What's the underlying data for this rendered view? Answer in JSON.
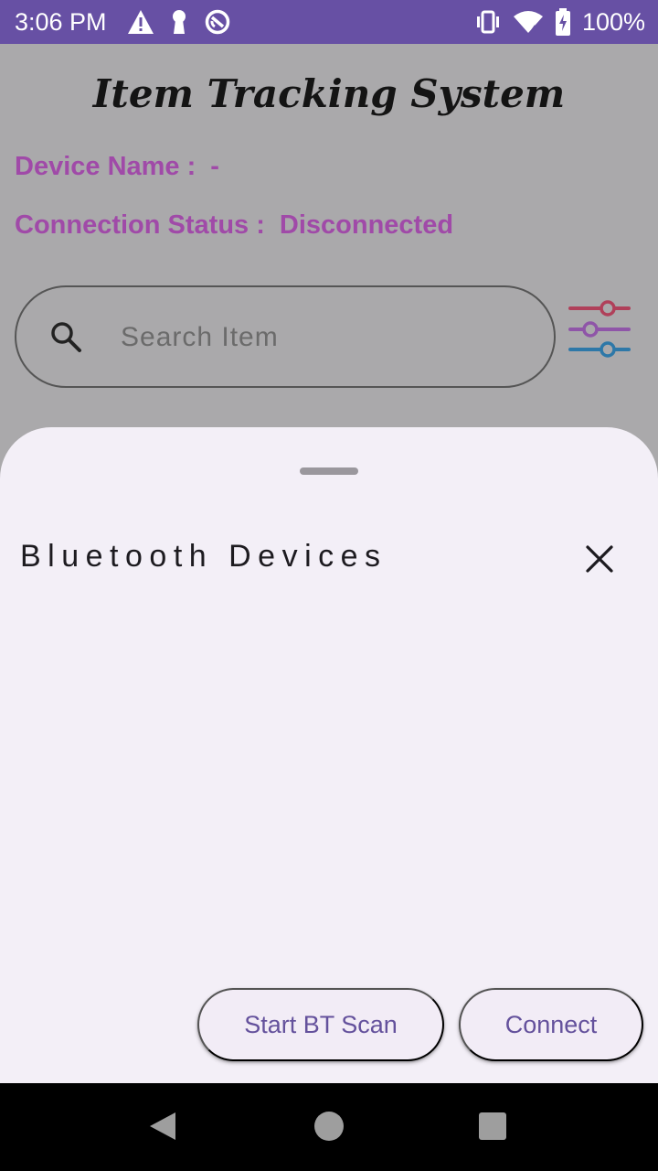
{
  "status_bar": {
    "time": "3:06 PM",
    "battery": "100%",
    "icons_left": [
      "warning-icon",
      "keyhole-icon",
      "sync-icon"
    ],
    "icons_right": [
      "vibrate-icon",
      "wifi-icon",
      "battery-charging-icon"
    ]
  },
  "app": {
    "title": "Item Tracking System",
    "device_name_label": "Device Name :",
    "device_name_value": "-",
    "connection_status_label": "Connection Status :",
    "connection_status_value": "Disconnected",
    "search": {
      "placeholder": "Search Item",
      "value": ""
    },
    "filter_icon": "filter-sliders-icon",
    "colors": {
      "status_bar": "#6750a4",
      "info_text": "#a04aa8",
      "slider_red": "#b0405a",
      "slider_purple": "#8f55a8",
      "slider_blue": "#2e78a8"
    }
  },
  "sheet": {
    "title": "Bluetooth Devices",
    "devices": [],
    "start_scan_label": "Start BT Scan",
    "connect_label": "Connect",
    "button_text_color": "#64519c"
  },
  "nav_bar": {
    "icons": [
      "back-icon",
      "home-icon",
      "recents-icon"
    ]
  }
}
